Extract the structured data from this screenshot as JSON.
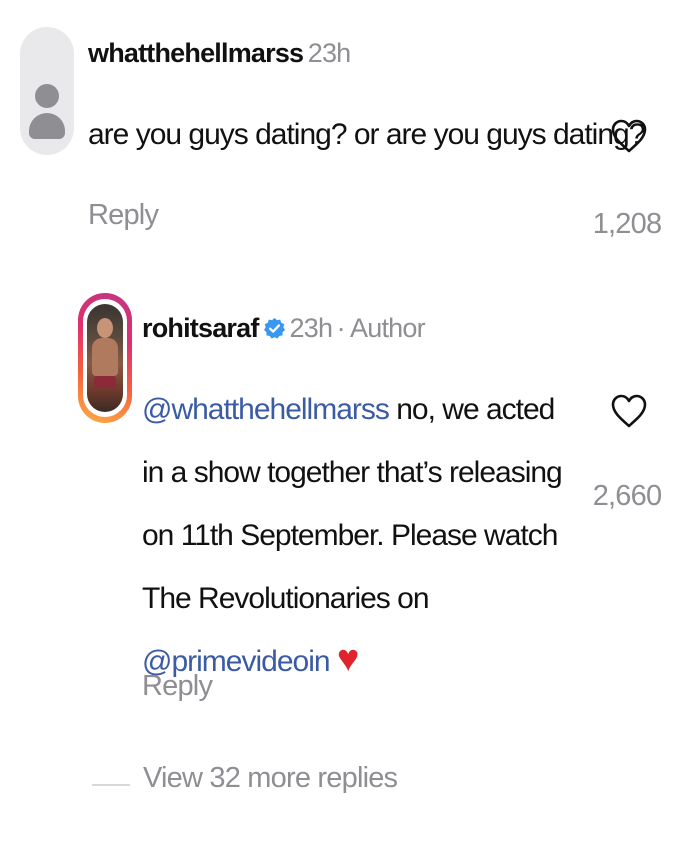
{
  "comments": [
    {
      "username": "whatthehellmarss",
      "time": "23h",
      "text": "are you guys dating? or are you guys dating?",
      "reply_label": "Reply",
      "likes": "1,208",
      "avatar": "default-user-avatar"
    },
    {
      "username": "rohitsaraf",
      "time": "23h",
      "author_tag": "· Author",
      "verified": true,
      "mention": "@whatthehellmarss",
      "text_part1": " no, we acted in a show together that’s releasing on 11th September. Please watch The Revolutionaries on ",
      "mention2": "@primevideoin",
      "emoji": "♥",
      "reply_label": "Reply",
      "likes": "2,660",
      "avatar": "story-ring-photo"
    }
  ],
  "view_more_replies": "View 32 more replies",
  "colors": {
    "mention": "#3b5ba5",
    "secondary_text": "#8e8e93",
    "verified_badge": "#3897f0",
    "heart_emoji": "#e0242d"
  },
  "icons": [
    "heart-outline-icon",
    "verified-badge-icon",
    "red-heart-emoji"
  ]
}
